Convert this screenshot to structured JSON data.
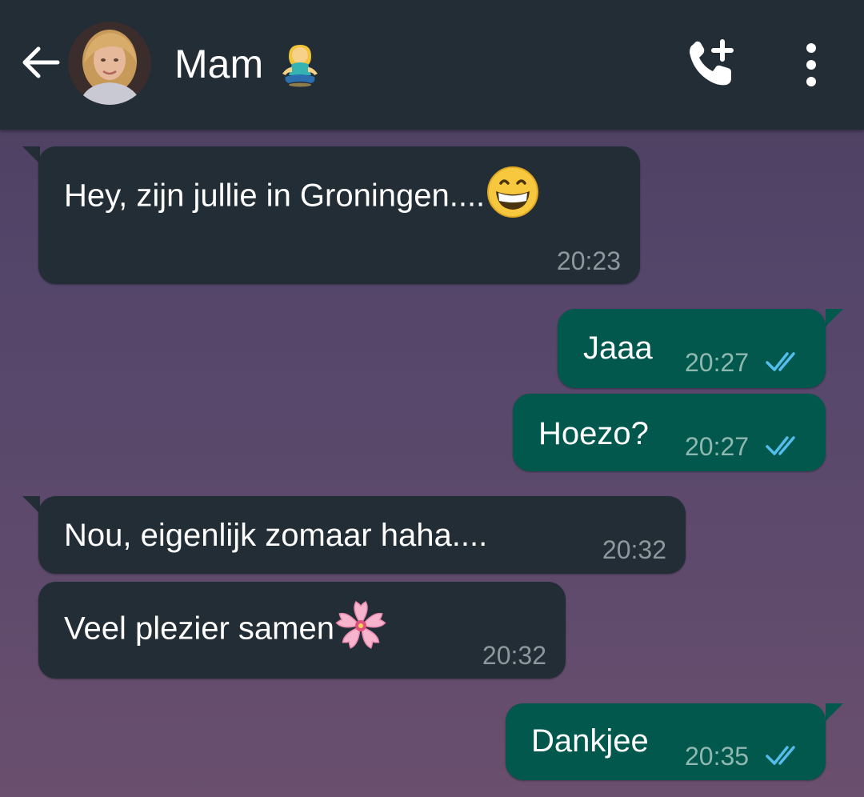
{
  "header": {
    "contact_name": "Mam",
    "status_emoji": "person-in-lotus-position-emoji"
  },
  "messages": [
    {
      "direction": "incoming",
      "text": "Hey, zijn jullie in Groningen....",
      "emoji": "grinning-face-with-smiling-eyes",
      "time": "20:23"
    },
    {
      "direction": "outgoing",
      "text": "Jaaa",
      "time": "20:27",
      "status": "read"
    },
    {
      "direction": "outgoing",
      "text": "Hoezo?",
      "time": "20:27",
      "status": "read"
    },
    {
      "direction": "incoming",
      "text": "Nou, eigenlijk zomaar haha....",
      "time": "20:32"
    },
    {
      "direction": "incoming",
      "text": "Veel plezier samen",
      "emoji": "cherry-blossom",
      "time": "20:32"
    },
    {
      "direction": "outgoing",
      "text": "Dankjee",
      "time": "20:35",
      "status": "read"
    }
  ],
  "colors": {
    "header_bg": "#222d36",
    "incoming_bubble": "#222d36",
    "outgoing_bubble": "#02584c",
    "read_ticks": "#53bdeb",
    "wallpaper": "#54466a"
  }
}
